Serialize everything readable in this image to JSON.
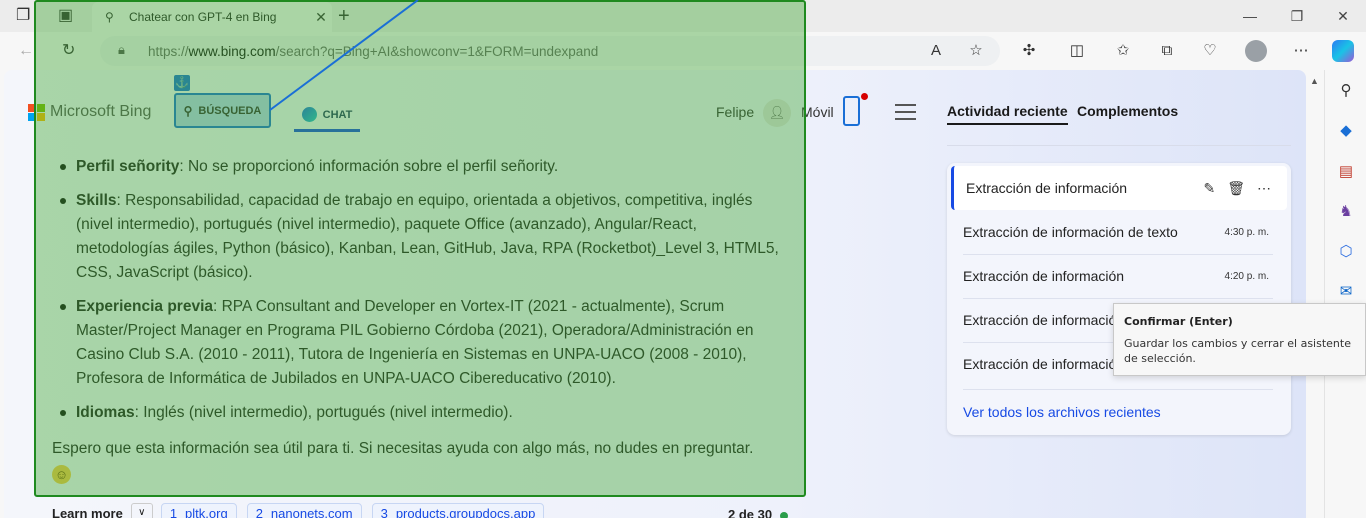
{
  "browser": {
    "tab_title": "Chatear con GPT-4 en Bing",
    "tab_icon": "search-icon",
    "new_tab_label": "+",
    "url_prefix": "https://",
    "url_domain": "www.bing.com",
    "url_path": "/search?q=Bing+AI&showconv=1&FORM=undexpand",
    "window_controls": [
      "minimize",
      "restore",
      "close"
    ],
    "toolbar_icons": [
      "read-aloud-icon",
      "favorite-star-icon",
      "extensions-icon",
      "split-screen-icon",
      "favorites-icon",
      "collections-icon",
      "browser-essentials-icon",
      "profile-icon",
      "more-icon",
      "copilot-icon"
    ]
  },
  "header": {
    "brand": "Microsoft Bing",
    "nav_search_label": "BÚSQUEDA",
    "nav_chat_label": "CHAT",
    "anchor_icon": "⚓",
    "user_name": "Felipe",
    "mobile_label": "Móvil"
  },
  "right_panel": {
    "tab_activity": "Actividad reciente",
    "tab_plugins": "Complementos",
    "items": [
      {
        "label": "Extracción de información",
        "time": "",
        "active": true
      },
      {
        "label": "Extracción de información de texto",
        "time": "4:30 p. m."
      },
      {
        "label": "Extracción de información",
        "time": "4:20 p. m."
      },
      {
        "label": "Extracción de informació",
        "time": ""
      },
      {
        "label": "Extracción de informació",
        "time": ""
      }
    ],
    "view_all": "Ver todos los archivos recientes"
  },
  "tooltip": {
    "title": "Confirmar (Enter)",
    "body": "Guardar los cambios y cerrar el asistente de selección."
  },
  "chat": {
    "bullets": [
      {
        "key": "Perfil señority",
        "text": ": No se proporcionó información sobre el perfil señority."
      },
      {
        "key": "Skills",
        "text": ": Responsabilidad, capacidad de trabajo en equipo, orientada a objetivos, competitiva, inglés (nivel intermedio), portugués (nivel intermedio), paquete Office (avanzado), Angular/React, metodologías ágiles, Python (básico), Kanban, Lean, GitHub, Java, RPA (Rocketbot)_Level 3, HTML5, CSS, JavaScript (básico)."
      },
      {
        "key": "Experiencia previa",
        "text": ": RPA Consultant and Developer en Vortex-IT (2021 - actualmente), Scrum Master/Project Manager en Programa PIL Gobierno Córdoba (2021), Operadora/Administración en Casino Club S.A. (2010 - 2011), Tutora de Ingeniería en Sistemas en UNPA-UACO (2008 - 2010), Profesora de Informática de Jubilados en UNPA-UACO Cibereducativo (2010)."
      },
      {
        "key": "Idiomas",
        "text": ": Inglés (nivel intermedio), portugués (nivel intermedio)."
      }
    ],
    "closing": "Espero que esta información sea útil para ti. Si necesitas ayuda con algo más, no dudes en preguntar.",
    "emoji": "☺"
  },
  "learn_more": {
    "label": "Learn more",
    "sources": [
      {
        "num": "1",
        "domain": "pltk.org"
      },
      {
        "num": "2",
        "domain": "nanonets.com"
      },
      {
        "num": "3",
        "domain": "products.groupdocs.app"
      }
    ],
    "page_count": "2 de 30"
  },
  "colors": {
    "accent": "#174ae4",
    "overlay": "#40a834",
    "tooltip_bg": "#f7f7f7"
  }
}
